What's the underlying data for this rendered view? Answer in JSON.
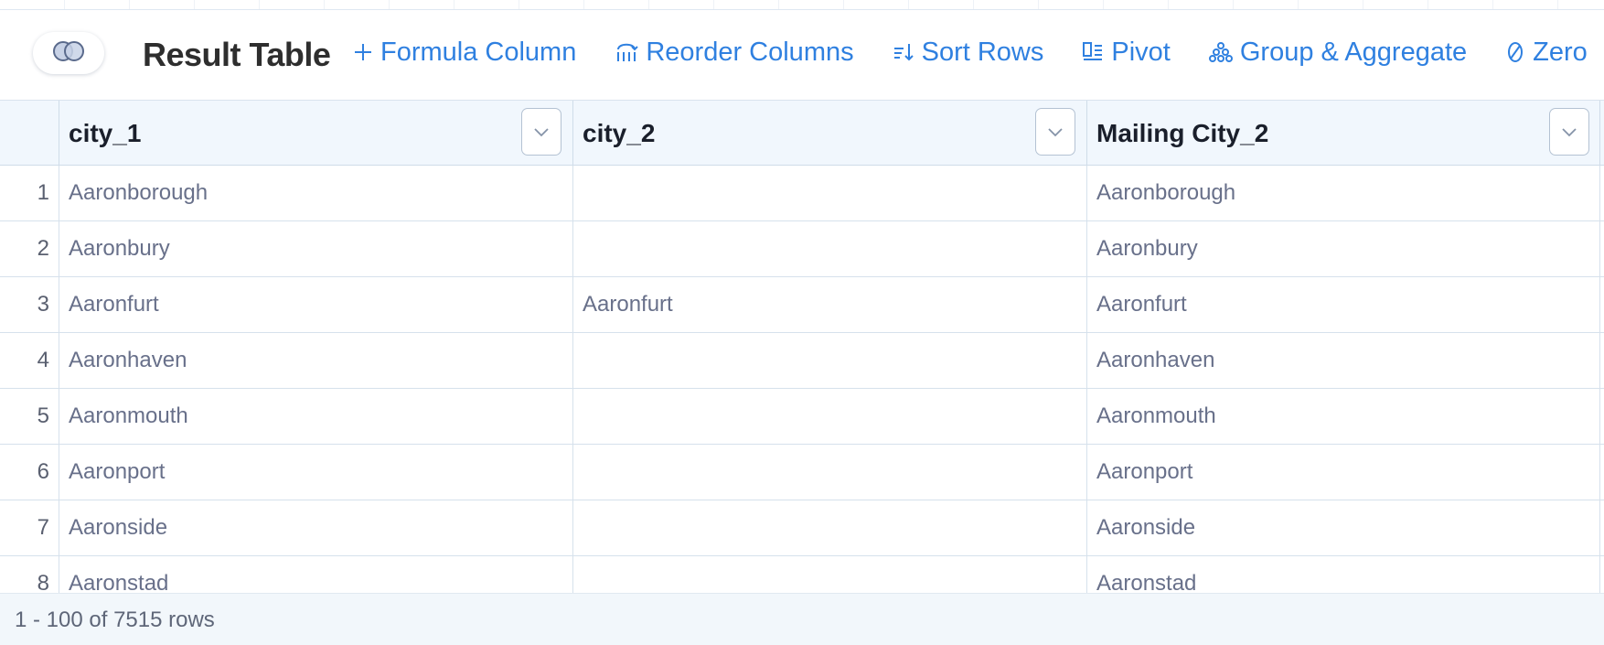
{
  "header": {
    "title": "Result Table",
    "toggle_icon": "venn-circles-icon",
    "actions": [
      {
        "label": "Formula Column",
        "icon": "plus-icon"
      },
      {
        "label": "Reorder Columns",
        "icon": "reorder-columns-icon"
      },
      {
        "label": "Sort Rows",
        "icon": "sort-icon"
      },
      {
        "label": "Pivot",
        "icon": "pivot-icon"
      },
      {
        "label": "Group & Aggregate",
        "icon": "group-icon"
      },
      {
        "label": "Zero",
        "icon": "zero-icon"
      }
    ]
  },
  "table": {
    "columns": [
      "city_1",
      "city_2",
      "Mailing City_2"
    ],
    "rows": [
      {
        "index": "1",
        "cells": [
          "Aaronborough",
          "",
          "Aaronborough"
        ]
      },
      {
        "index": "2",
        "cells": [
          "Aaronbury",
          "",
          "Aaronbury"
        ]
      },
      {
        "index": "3",
        "cells": [
          "Aaronfurt",
          "Aaronfurt",
          "Aaronfurt"
        ]
      },
      {
        "index": "4",
        "cells": [
          "Aaronhaven",
          "",
          "Aaronhaven"
        ]
      },
      {
        "index": "5",
        "cells": [
          "Aaronmouth",
          "",
          "Aaronmouth"
        ]
      },
      {
        "index": "6",
        "cells": [
          "Aaronport",
          "",
          "Aaronport"
        ]
      },
      {
        "index": "7",
        "cells": [
          "Aaronside",
          "",
          "Aaronside"
        ]
      },
      {
        "index": "8",
        "cells": [
          "Aaronstad",
          "",
          "Aaronstad"
        ]
      }
    ]
  },
  "footer": {
    "rows_status": "1 - 100 of 7515 rows"
  },
  "colors": {
    "accent": "#2f80e0",
    "header_bg": "#f1f7fd",
    "footer_bg": "#f2f7fb",
    "cell_text": "#68708a"
  }
}
